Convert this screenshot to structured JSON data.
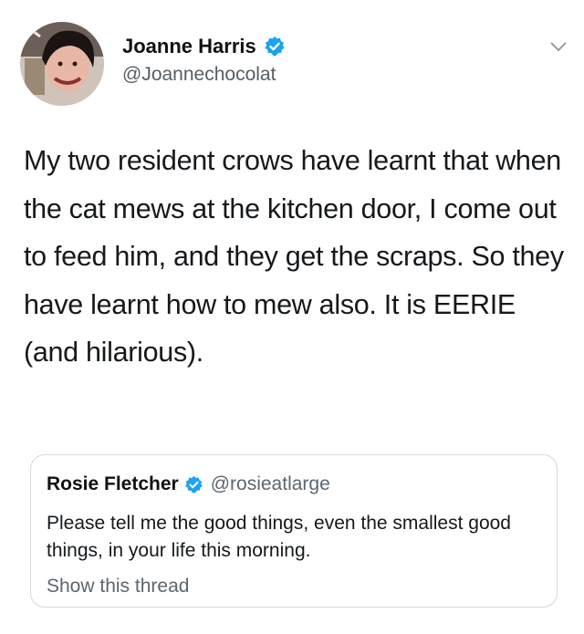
{
  "author": {
    "display_name": "Joanne Harris",
    "handle": "@Joannechocolat",
    "avatar_icon": "profile-photo",
    "verified_icon": "verified-badge-icon",
    "verified_color": "#1da1f2"
  },
  "tweet": {
    "text": "My two resident crows have learnt that when the cat mews at the kitchen door, I come out to feed him, and they get the scraps. So they have learnt how to mew also. It is EERIE (and hilarious)."
  },
  "quoted_tweet": {
    "display_name": "Rosie Fletcher",
    "handle": "@rosieatlarge",
    "text": "Please tell me the good things, even the smallest good things, in your life this morning.",
    "show_thread_label": "Show this thread"
  },
  "menu_icon": "chevron-down-icon"
}
